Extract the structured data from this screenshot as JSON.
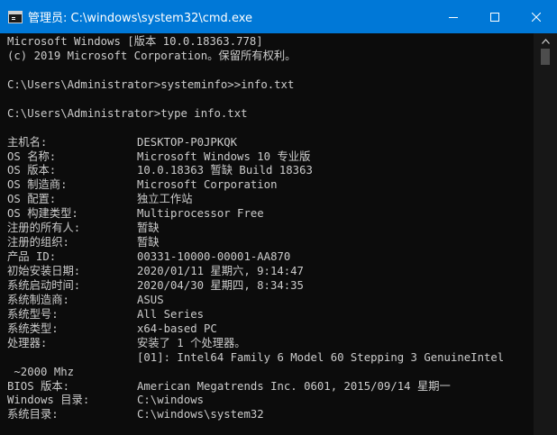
{
  "window": {
    "title": "管理员: C:\\windows\\system32\\cmd.exe"
  },
  "console": {
    "header": [
      "Microsoft Windows [版本 10.0.18363.778]",
      "(c) 2019 Microsoft Corporation。保留所有权利。"
    ],
    "commands": [
      "C:\\Users\\Administrator>systeminfo>>info.txt",
      "C:\\Users\\Administrator>type info.txt"
    ],
    "info": [
      {
        "key": "主机名:",
        "value": "DESKTOP-P0JPKQK"
      },
      {
        "key": "OS 名称:",
        "value": "Microsoft Windows 10 专业版"
      },
      {
        "key": "OS 版本:",
        "value": "10.0.18363 暂缺 Build 18363"
      },
      {
        "key": "OS 制造商:",
        "value": "Microsoft Corporation"
      },
      {
        "key": "OS 配置:",
        "value": "独立工作站"
      },
      {
        "key": "OS 构建类型:",
        "value": "Multiprocessor Free"
      },
      {
        "key": "注册的所有人:",
        "value": "暂缺"
      },
      {
        "key": "注册的组织:",
        "value": "暂缺"
      },
      {
        "key": "产品 ID:",
        "value": "00331-10000-00001-AA870"
      },
      {
        "key": "初始安装日期:",
        "value": "2020/01/11 星期六, 9:14:47"
      },
      {
        "key": "系统启动时间:",
        "value": "2020/04/30 星期四, 8:34:35"
      },
      {
        "key": "系统制造商:",
        "value": "ASUS"
      },
      {
        "key": "系统型号:",
        "value": "All Series"
      },
      {
        "key": "系统类型:",
        "value": "x64-based PC"
      },
      {
        "key": "处理器:",
        "value": "安装了 1 个处理器。"
      },
      {
        "key": "",
        "value": "[01]: Intel64 Family 6 Model 60 Stepping 3 GenuineIntel"
      }
    ],
    "wrap_line": " ~2000 Mhz",
    "info2": [
      {
        "key": "BIOS 版本:",
        "value": "American Megatrends Inc. 0601, 2015/09/14 星期一"
      },
      {
        "key": "Windows 目录:",
        "value": "C:\\windows"
      },
      {
        "key": "系统目录:",
        "value": "C:\\windows\\system32"
      }
    ]
  }
}
